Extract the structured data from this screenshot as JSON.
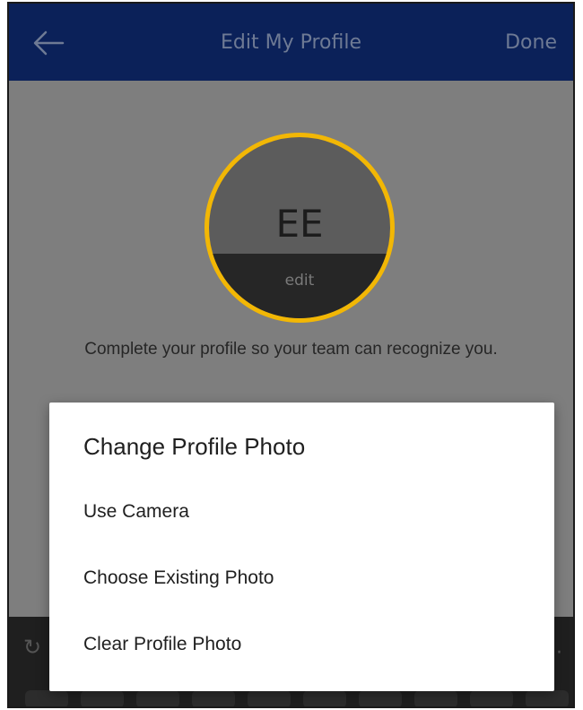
{
  "header": {
    "title": "Edit My Profile",
    "done_label": "Done",
    "back_icon": "arrow-left-icon"
  },
  "profile": {
    "initials": "EE",
    "edit_label": "edit",
    "hint": "Complete your profile so your team can recognize you."
  },
  "dialog": {
    "title": "Change Profile Photo",
    "options": [
      {
        "label": "Use Camera"
      },
      {
        "label": "Choose Existing Photo"
      },
      {
        "label": "Clear Profile Photo"
      }
    ]
  },
  "colors": {
    "header_bg": "#0b2159",
    "avatar_ring": "#f2b705",
    "scrim": "#7e7e7e"
  }
}
